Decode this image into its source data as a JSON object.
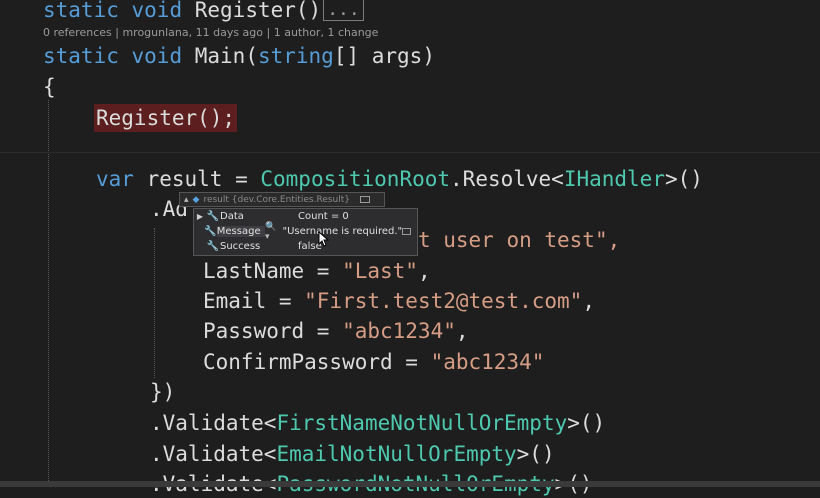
{
  "code": {
    "l1": {
      "kw1": "static",
      "kw2": "void",
      "name": "Register()",
      "collapsed": "..."
    },
    "codelens": "0 references | mrogunlana, 11 days ago | 1 author, 1 change",
    "l2": {
      "kw1": "static",
      "kw2": "void",
      "name": "Main(",
      "kw3": "string",
      "rest": "[] args)"
    },
    "l3": "{",
    "l4": "Register();",
    "l5": {
      "kw": "var",
      "mid": " result = ",
      "ty1": "CompositionRoot",
      "dot": ".Resolve<",
      "ty2": "IHandler",
      "end": ">()"
    },
    "l6": ".Ad",
    "l7": {
      "hidden": "st user on test\",",
      "visible": "st user on test\","
    },
    "l8": {
      "prop": "LastName = ",
      "val": "\"Last\"",
      "end": ","
    },
    "l9": {
      "prop": "Email = ",
      "val": "\"First.test2@test.com\"",
      "end": ","
    },
    "l10": {
      "prop": "Password = ",
      "val": "\"abc1234\"",
      "end": ","
    },
    "l11": {
      "prop": "ConfirmPassword = ",
      "val": "\"abc1234\""
    },
    "l12": "})",
    "l13": {
      "pre": ".Validate<",
      "ty": "FirstNameNotNullOrEmpty",
      "post": ">()"
    },
    "l14": {
      "pre": ".Validate<",
      "ty": "EmailNotNullOrEmpty",
      "post": ">()"
    },
    "l15": {
      "pre": ".Validate<",
      "ty": "PasswordNotNullOrEmpty",
      "post": ">()"
    }
  },
  "datatip": {
    "header": "result {dev.Core.Entities.Result}",
    "rows": [
      {
        "name": "Data",
        "value": "Count = 0"
      },
      {
        "name": "Message",
        "value": "\"Username is required.\""
      },
      {
        "name": "Success",
        "value": "false"
      }
    ]
  }
}
